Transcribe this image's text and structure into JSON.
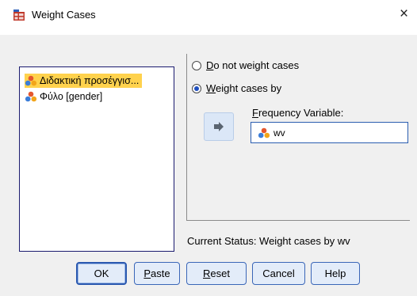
{
  "window": {
    "title": "Weight Cases",
    "close_glyph": "×"
  },
  "variables": [
    {
      "label": "Διδακτική προσέγγισ...",
      "icon": "nominal-variable-icon",
      "selected": true
    },
    {
      "label": "Φύλο [gender]",
      "icon": "nominal-variable-icon",
      "selected": false
    }
  ],
  "options": {
    "do_not_weight": {
      "mnemonic": "D",
      "rest": "o not weight cases",
      "selected": false
    },
    "weight_by": {
      "mnemonic": "W",
      "rest": "eight cases by",
      "selected": true
    }
  },
  "frequency": {
    "label_mnemonic": "F",
    "label_rest": "requency Variable:",
    "value": "wv",
    "icon": "nominal-variable-icon"
  },
  "move_button": {
    "icon": "arrow-right-icon"
  },
  "status": "Current Status: Weight cases by wv",
  "buttons": {
    "ok": "OK",
    "paste": {
      "mnemonic": "P",
      "rest": "aste"
    },
    "reset": {
      "mnemonic": "R",
      "rest": "eset"
    },
    "cancel": "Cancel",
    "help": "Help"
  },
  "colors": {
    "accent": "#2b59b0",
    "selection": "#ffd24d",
    "panel_bg": "#f0f0f0",
    "button_bg": "#e3ecf9"
  }
}
